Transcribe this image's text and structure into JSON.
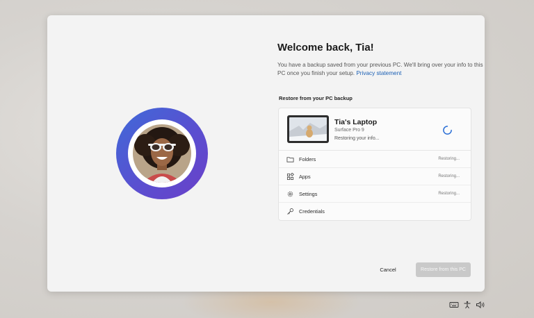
{
  "window": {
    "title": "Welcome back, Tia!",
    "description": "You have a backup saved from your previous PC. We'll bring over your info to this PC once you finish your setup.",
    "privacy_link": "Privacy statement"
  },
  "backup": {
    "section_label": "Restore from your PC backup",
    "device": {
      "name": "Tia's Laptop",
      "model": "Surface Pro 9",
      "status": "Restoring your info..."
    },
    "items": [
      {
        "label": "Folders",
        "status": "Restoring...",
        "icon": "folder-icon"
      },
      {
        "label": "Apps",
        "status": "Restoring...",
        "icon": "apps-icon"
      },
      {
        "label": "Settings",
        "status": "Restoring...",
        "icon": "gear-icon"
      },
      {
        "label": "Credentials",
        "status": "",
        "icon": "key-icon"
      }
    ]
  },
  "actions": {
    "cancel_label": "Cancel",
    "restore_label": "Restore from this PC"
  },
  "taskbar": {
    "icons": [
      "keyboard-icon",
      "accessibility-icon",
      "volume-icon"
    ]
  },
  "colors": {
    "accent_ring_start": "#3f6ad8",
    "accent_ring_end": "#6a3fc8",
    "link": "#1a5fb4",
    "spinner": "#2b6fd6",
    "disabled_button": "#c9c9c9"
  }
}
